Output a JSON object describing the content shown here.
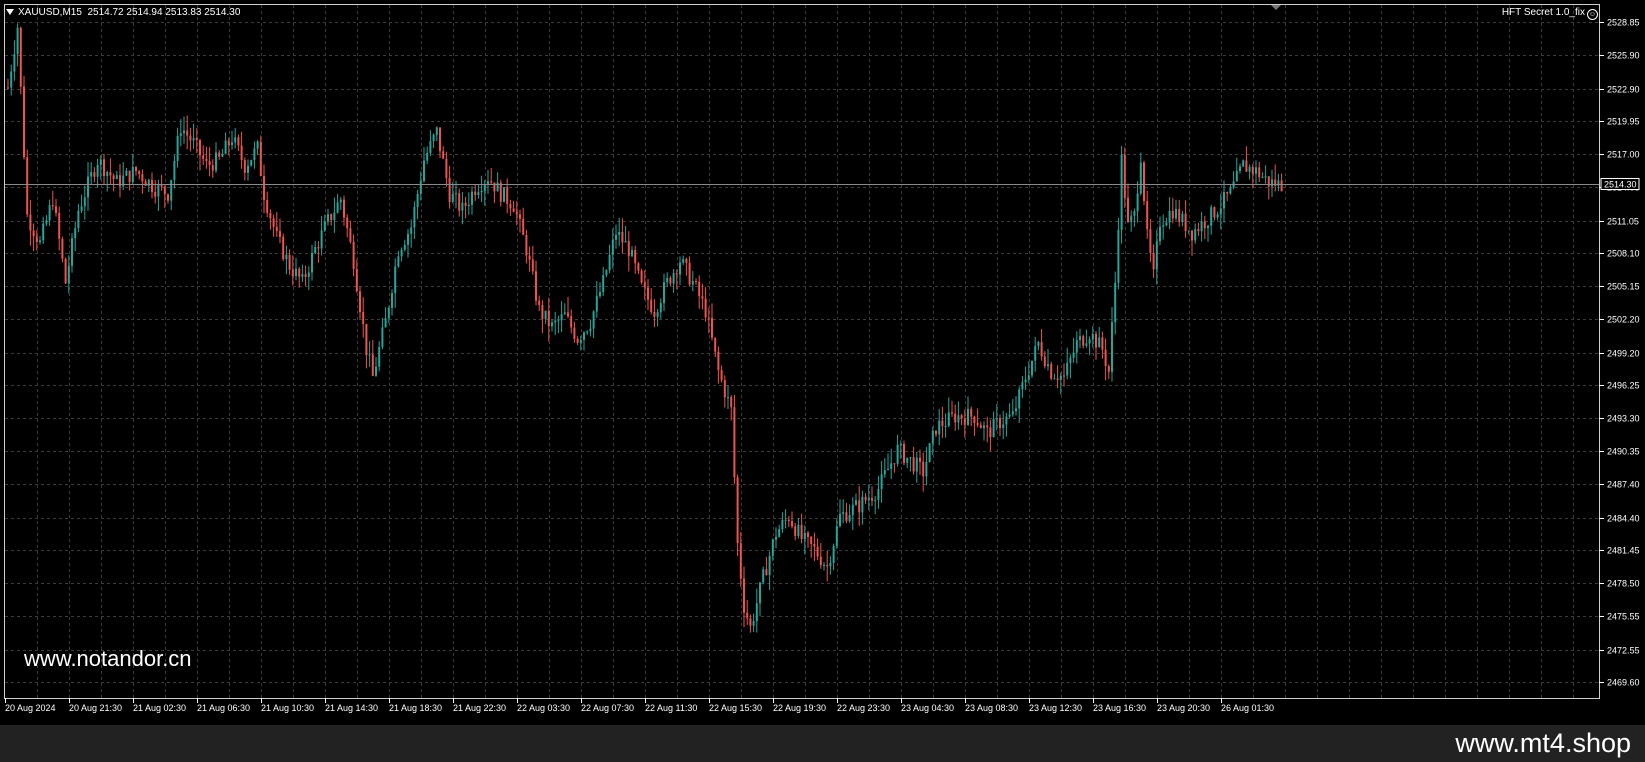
{
  "chart_header": {
    "symbol": "XAUUSD,M15",
    "ohlc": "2514.72 2514.94 2513.83 2514.30",
    "expert_label": "HFT Secret 1.0_fix"
  },
  "watermark": "www.notandor.cn",
  "site_label": "www.mt4.shop",
  "colors": {
    "background": "#000000",
    "grid": "#4a4a4a",
    "bull": "#26a69a",
    "bear": "#ef5350",
    "axis_text": "#ffffff",
    "current_price_line": "#8a8a8a"
  },
  "chart_data": {
    "type": "candlestick",
    "symbol": "XAUUSD",
    "timeframe": "M15",
    "current_price": "2514.30",
    "ylim": [
      2468.2,
      2530.4
    ],
    "y_ticks": [
      "2528.85",
      "2525.90",
      "2522.90",
      "2519.95",
      "2517.00",
      "2514.05",
      "2511.05",
      "2508.10",
      "2505.15",
      "2502.20",
      "2499.20",
      "2496.25",
      "2493.30",
      "2490.35",
      "2487.40",
      "2484.40",
      "2481.45",
      "2478.50",
      "2475.55",
      "2472.55",
      "2469.60"
    ],
    "x_ticks": [
      "20 Aug 2024",
      "20 Aug 21:30",
      "21 Aug 02:30",
      "21 Aug 06:30",
      "21 Aug 10:30",
      "21 Aug 14:30",
      "21 Aug 18:30",
      "21 Aug 22:30",
      "22 Aug 03:30",
      "22 Aug 07:30",
      "22 Aug 11:30",
      "22 Aug 15:30",
      "22 Aug 19:30",
      "22 Aug 23:30",
      "23 Aug 04:30",
      "23 Aug 08:30",
      "23 Aug 12:30",
      "23 Aug 16:30",
      "23 Aug 20:30",
      "26 Aug 01:30"
    ],
    "grid": true,
    "close_path": [
      [
        0,
        2523.0
      ],
      [
        3,
        2528.5
      ],
      [
        6,
        2511.5
      ],
      [
        10,
        2509.0
      ],
      [
        14,
        2513.0
      ],
      [
        18,
        2505.5
      ],
      [
        22,
        2512.0
      ],
      [
        28,
        2516.5
      ],
      [
        34,
        2514.5
      ],
      [
        40,
        2515.5
      ],
      [
        46,
        2514.0
      ],
      [
        50,
        2513.5
      ],
      [
        54,
        2519.5
      ],
      [
        58,
        2518.0
      ],
      [
        62,
        2516.0
      ],
      [
        66,
        2516.5
      ],
      [
        70,
        2518.5
      ],
      [
        74,
        2516.0
      ],
      [
        78,
        2517.5
      ],
      [
        80,
        2513.5
      ],
      [
        84,
        2509.5
      ],
      [
        88,
        2507.0
      ],
      [
        92,
        2505.5
      ],
      [
        96,
        2508.5
      ],
      [
        100,
        2511.0
      ],
      [
        104,
        2513.0
      ],
      [
        108,
        2507.5
      ],
      [
        112,
        2499.5
      ],
      [
        114,
        2497.0
      ],
      [
        118,
        2502.0
      ],
      [
        122,
        2508.5
      ],
      [
        126,
        2510.5
      ],
      [
        130,
        2516.5
      ],
      [
        134,
        2519.0
      ],
      [
        138,
        2513.5
      ],
      [
        142,
        2512.0
      ],
      [
        146,
        2514.0
      ],
      [
        150,
        2515.0
      ],
      [
        154,
        2513.5
      ],
      [
        158,
        2512.5
      ],
      [
        162,
        2508.5
      ],
      [
        166,
        2503.0
      ],
      [
        170,
        2501.5
      ],
      [
        174,
        2502.5
      ],
      [
        178,
        2500.5
      ],
      [
        182,
        2502.0
      ],
      [
        186,
        2505.5
      ],
      [
        190,
        2510.0
      ],
      [
        194,
        2508.5
      ],
      [
        198,
        2505.0
      ],
      [
        202,
        2503.0
      ],
      [
        206,
        2505.5
      ],
      [
        210,
        2507.5
      ],
      [
        214,
        2505.5
      ],
      [
        218,
        2503.0
      ],
      [
        222,
        2497.5
      ],
      [
        226,
        2494.0
      ],
      [
        228,
        2482.0
      ],
      [
        230,
        2476.5
      ],
      [
        232,
        2474.5
      ],
      [
        236,
        2479.0
      ],
      [
        240,
        2483.0
      ],
      [
        244,
        2484.5
      ],
      [
        248,
        2482.5
      ],
      [
        252,
        2481.5
      ],
      [
        256,
        2480.0
      ],
      [
        260,
        2484.5
      ],
      [
        266,
        2485.5
      ],
      [
        272,
        2487.0
      ],
      [
        278,
        2490.5
      ],
      [
        282,
        2489.5
      ],
      [
        286,
        2488.5
      ],
      [
        290,
        2492.5
      ],
      [
        296,
        2493.5
      ],
      [
        302,
        2493.5
      ],
      [
        306,
        2492.0
      ],
      [
        310,
        2493.0
      ],
      [
        314,
        2493.5
      ],
      [
        318,
        2497.0
      ],
      [
        322,
        2500.0
      ],
      [
        326,
        2497.5
      ],
      [
        330,
        2497.0
      ],
      [
        334,
        2500.0
      ],
      [
        338,
        2501.0
      ],
      [
        342,
        2499.5
      ],
      [
        344,
        2497.5
      ],
      [
        346,
        2505.5
      ],
      [
        348,
        2516.5
      ],
      [
        350,
        2510.5
      ],
      [
        352,
        2511.5
      ],
      [
        354,
        2517.0
      ],
      [
        356,
        2509.5
      ],
      [
        358,
        2506.0
      ],
      [
        360,
        2511.0
      ],
      [
        364,
        2512.0
      ],
      [
        370,
        2510.0
      ],
      [
        376,
        2511.5
      ],
      [
        382,
        2513.5
      ],
      [
        386,
        2516.0
      ],
      [
        390,
        2515.5
      ],
      [
        394,
        2514.5
      ],
      [
        398,
        2514.3
      ]
    ],
    "price_range": [
      2468.2,
      2530.4
    ]
  }
}
